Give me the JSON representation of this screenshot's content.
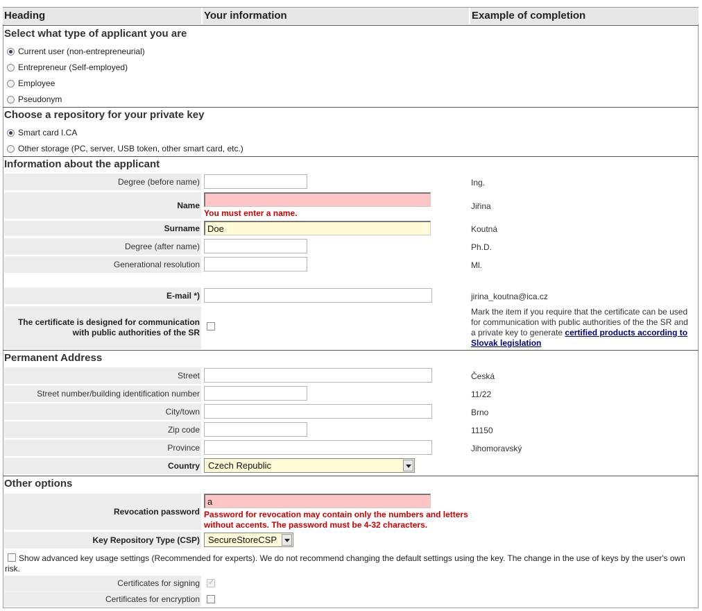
{
  "header": {
    "col1": "Heading",
    "col2": "Your information",
    "col3": "Example of completion"
  },
  "applicant_type": {
    "title": "Select what type of applicant you are",
    "options": [
      "Current user (non-entrepreneurial)",
      "Entrepreneur (Self-employed)",
      "Employee",
      "Pseudonym"
    ],
    "selected": "Current user (non-entrepreneurial)"
  },
  "repository": {
    "title": "Choose a repository for your private key",
    "options": [
      "Smart card I.CA",
      "Other storage (PC, server, USB token, other smart card, etc.)"
    ],
    "selected": "Smart card I.CA"
  },
  "applicant": {
    "title": "Information about the applicant",
    "degree_before": {
      "label": "Degree (before name)",
      "value": "",
      "example": "Ing."
    },
    "name": {
      "label": "Name",
      "value": "",
      "error": "You must enter a name.",
      "example": "Jiřina"
    },
    "surname": {
      "label": "Surname",
      "value": "Doe",
      "example": "Koutná"
    },
    "degree_after": {
      "label": "Degree (after name)",
      "value": "",
      "example": "Ph.D."
    },
    "generational": {
      "label": "Generational resolution",
      "value": "",
      "example": "Ml."
    },
    "email": {
      "label": "E-mail *)",
      "value": "",
      "example": "jirina_koutna@ica.cz"
    },
    "public_auth": {
      "label_line1": "The certificate is designed for communication",
      "label_line2": "with public authorities of the SR",
      "example_line1": "Mark the item if you require that the certificate can be used",
      "example_line2": "for communication with public authorities of the the SR and",
      "example_line3_prefix": "a private key to generate ",
      "example_link_part1": "certified products according to",
      "example_link_part2": "Slovak legislation"
    }
  },
  "address": {
    "title": "Permanent Address",
    "street": {
      "label": "Street",
      "value": "",
      "example": "Česká"
    },
    "street_number": {
      "label": "Street number/building identification number",
      "value": "",
      "example": "11/22"
    },
    "city": {
      "label": "City/town",
      "value": "",
      "example": "Brno"
    },
    "zip": {
      "label": "Zip code",
      "value": "",
      "example": "11150"
    },
    "province": {
      "label": "Province",
      "value": "",
      "example": "Jihomoravský"
    },
    "country": {
      "label": "Country",
      "value": "Czech Republic"
    }
  },
  "other": {
    "title": "Other options",
    "revocation": {
      "label": "Revocation password",
      "value": "a",
      "error_line1": "Password for revocation may contain only the numbers and letters",
      "error_line2": "without accents. The password must be 4-32 characters."
    },
    "csp": {
      "label": "Key Repository Type (CSP)",
      "value": "SecureStoreCSP"
    },
    "advanced_line1": "Show advanced key usage settings (Recommended for experts). We do not recommend changing the default settings using the key. The change in the use of keys by the user's",
    "advanced_line2": "own risk.",
    "signing": {
      "label": "Certificates for signing"
    },
    "encryption": {
      "label": "Certificates for encryption"
    }
  }
}
